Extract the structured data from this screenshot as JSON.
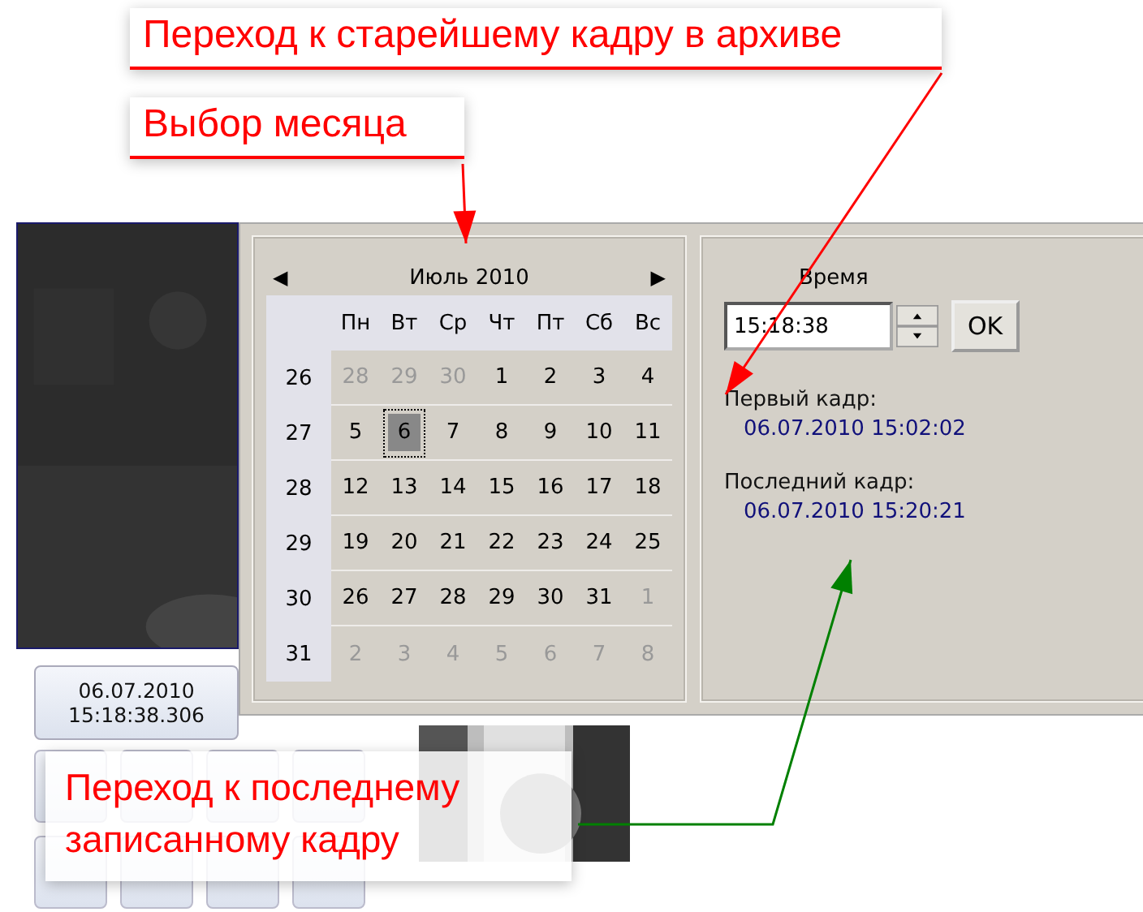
{
  "annotations": [
    {
      "kind": "top",
      "text": "Переход к старейшему кадру в архиве",
      "color": "#ff0000"
    },
    {
      "kind": "month",
      "text": "Выбор месяца",
      "color": "#ff0000"
    },
    {
      "kind": "bottom",
      "text": "Переход к последнему записанному кадру",
      "color": "#008000"
    }
  ],
  "player": {
    "date": "06.07.2010",
    "time": "15:18:38.306"
  },
  "calendar": {
    "prev": "◀",
    "month": "Июль 2010",
    "next": "▶",
    "weekdays": [
      "Пн",
      "Вт",
      "Ср",
      "Чт",
      "Пт",
      "Сб",
      "Вс"
    ],
    "weeks": [
      {
        "number": "26",
        "days": [
          {
            "label": "28",
            "other_month": true,
            "selected": false
          },
          {
            "label": "29",
            "other_month": true,
            "selected": false
          },
          {
            "label": "30",
            "other_month": true,
            "selected": false
          },
          {
            "label": "1",
            "other_month": false,
            "selected": false
          },
          {
            "label": "2",
            "other_month": false,
            "selected": false
          },
          {
            "label": "3",
            "other_month": false,
            "selected": false
          },
          {
            "label": "4",
            "other_month": false,
            "selected": false
          }
        ]
      },
      {
        "number": "27",
        "days": [
          {
            "label": "5",
            "other_month": false,
            "selected": false
          },
          {
            "label": "6",
            "other_month": false,
            "selected": true
          },
          {
            "label": "7",
            "other_month": false,
            "selected": false
          },
          {
            "label": "8",
            "other_month": false,
            "selected": false
          },
          {
            "label": "9",
            "other_month": false,
            "selected": false
          },
          {
            "label": "10",
            "other_month": false,
            "selected": false
          },
          {
            "label": "11",
            "other_month": false,
            "selected": false
          }
        ]
      },
      {
        "number": "28",
        "days": [
          {
            "label": "12",
            "other_month": false,
            "selected": false
          },
          {
            "label": "13",
            "other_month": false,
            "selected": false
          },
          {
            "label": "14",
            "other_month": false,
            "selected": false
          },
          {
            "label": "15",
            "other_month": false,
            "selected": false
          },
          {
            "label": "16",
            "other_month": false,
            "selected": false
          },
          {
            "label": "17",
            "other_month": false,
            "selected": false
          },
          {
            "label": "18",
            "other_month": false,
            "selected": false
          }
        ]
      },
      {
        "number": "29",
        "days": [
          {
            "label": "19",
            "other_month": false,
            "selected": false
          },
          {
            "label": "20",
            "other_month": false,
            "selected": false
          },
          {
            "label": "21",
            "other_month": false,
            "selected": false
          },
          {
            "label": "22",
            "other_month": false,
            "selected": false
          },
          {
            "label": "23",
            "other_month": false,
            "selected": false
          },
          {
            "label": "24",
            "other_month": false,
            "selected": false
          },
          {
            "label": "25",
            "other_month": false,
            "selected": false
          }
        ]
      },
      {
        "number": "30",
        "days": [
          {
            "label": "26",
            "other_month": false,
            "selected": false
          },
          {
            "label": "27",
            "other_month": false,
            "selected": false
          },
          {
            "label": "28",
            "other_month": false,
            "selected": false
          },
          {
            "label": "29",
            "other_month": false,
            "selected": false
          },
          {
            "label": "30",
            "other_month": false,
            "selected": false
          },
          {
            "label": "31",
            "other_month": false,
            "selected": false
          },
          {
            "label": "1",
            "other_month": true,
            "selected": false
          }
        ]
      },
      {
        "number": "31",
        "days": [
          {
            "label": "2",
            "other_month": true,
            "selected": false
          },
          {
            "label": "3",
            "other_month": true,
            "selected": false
          },
          {
            "label": "4",
            "other_month": true,
            "selected": false
          },
          {
            "label": "5",
            "other_month": true,
            "selected": false
          },
          {
            "label": "6",
            "other_month": true,
            "selected": false
          },
          {
            "label": "7",
            "other_month": true,
            "selected": false
          },
          {
            "label": "8",
            "other_month": true,
            "selected": false
          }
        ]
      }
    ]
  },
  "time_panel": {
    "label": "Время",
    "value": "15:18:38",
    "ok": "OK",
    "first_label": "Первый кадр:",
    "first_value": "06.07.2010 15:02:02",
    "last_label": "Последний кадр:",
    "last_value": "06.07.2010 15:20:21"
  }
}
